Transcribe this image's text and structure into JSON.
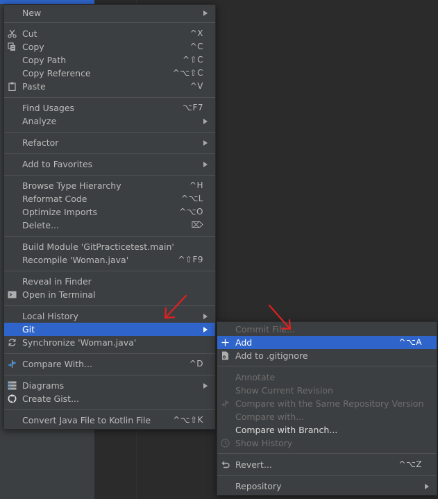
{
  "context_menu": {
    "items": [
      {
        "label": "New",
        "shortcut": "",
        "submenu": true
      },
      {
        "label": "Cut",
        "shortcut": "^X",
        "icon": "scissors-icon"
      },
      {
        "label": "Copy",
        "shortcut": "^C",
        "icon": "copy-icon"
      },
      {
        "label": "Copy Path",
        "shortcut": "^⇧C"
      },
      {
        "label": "Copy Reference",
        "shortcut": "^⌥⇧C"
      },
      {
        "label": "Paste",
        "shortcut": "^V",
        "icon": "clipboard-icon"
      },
      {
        "label": "Find Usages",
        "shortcut": "⌥F7"
      },
      {
        "label": "Analyze",
        "shortcut": "",
        "submenu": true
      },
      {
        "label": "Refactor",
        "shortcut": "",
        "submenu": true
      },
      {
        "label": "Add to Favorites",
        "shortcut": "",
        "submenu": true
      },
      {
        "label": "Browse Type Hierarchy",
        "shortcut": "^H"
      },
      {
        "label": "Reformat Code",
        "shortcut": "^⌥L"
      },
      {
        "label": "Optimize Imports",
        "shortcut": "^⌥O"
      },
      {
        "label": "Delete...",
        "shortcut": "⌦"
      },
      {
        "label": "Build Module 'GitPracticetest.main'",
        "shortcut": ""
      },
      {
        "label": "Recompile 'Woman.java'",
        "shortcut": "^⇧F9"
      },
      {
        "label": "Reveal in Finder",
        "shortcut": ""
      },
      {
        "label": "Open in Terminal",
        "shortcut": "",
        "icon": "terminal-icon"
      },
      {
        "label": "Local History",
        "shortcut": "",
        "submenu": true
      },
      {
        "label": "Git",
        "shortcut": "",
        "submenu": true,
        "selected": true
      },
      {
        "label": "Synchronize 'Woman.java'",
        "shortcut": "",
        "icon": "sync-icon"
      },
      {
        "label": "Compare With...",
        "shortcut": "^D",
        "icon": "compare-icon"
      },
      {
        "label": "Diagrams",
        "shortcut": "",
        "submenu": true,
        "icon": "diagram-icon"
      },
      {
        "label": "Create Gist...",
        "shortcut": "",
        "icon": "github-icon"
      },
      {
        "label": "Convert Java File to Kotlin File",
        "shortcut": "^⌥⇧K"
      }
    ]
  },
  "git_submenu": {
    "items": [
      {
        "label": "Commit File...",
        "shortcut": "",
        "disabled": true
      },
      {
        "label": "Add",
        "shortcut": "^⌥A",
        "selected": true,
        "icon": "plus-icon"
      },
      {
        "label": "Add to .gitignore",
        "shortcut": "",
        "icon": "gitignore-file-icon"
      },
      {
        "label": "Annotate",
        "shortcut": "",
        "disabled": true
      },
      {
        "label": "Show Current Revision",
        "shortcut": "",
        "disabled": true
      },
      {
        "label": "Compare with the Same Repository Version",
        "shortcut": "",
        "disabled": true,
        "icon": "compare-icon"
      },
      {
        "label": "Compare with...",
        "shortcut": "",
        "disabled": true
      },
      {
        "label": "Compare with Branch...",
        "shortcut": ""
      },
      {
        "label": "Show History",
        "shortcut": "",
        "disabled": true,
        "icon": "history-icon"
      },
      {
        "label": "Revert...",
        "shortcut": "^⌥Z",
        "icon": "revert-icon"
      },
      {
        "label": "Repository",
        "shortcut": "",
        "submenu": true
      }
    ]
  },
  "colors": {
    "menu_background": "#3c3f41",
    "selection": "#2f65ca",
    "text": "#bbbbbb",
    "disabled_text": "#6e6e6e",
    "separator": "#515151",
    "annotation_arrow": "#e02020"
  }
}
